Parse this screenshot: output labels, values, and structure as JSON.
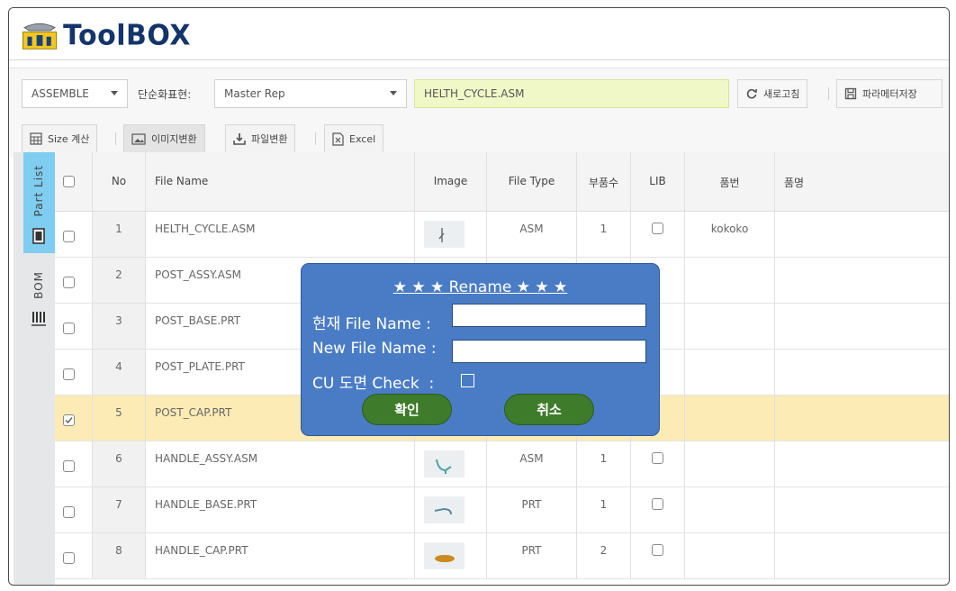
{
  "app": {
    "title": "ToolBOX"
  },
  "toolbar": {
    "assemble_value": "ASSEMBLE",
    "simplified_rep_label": "단순화표현:",
    "simplified_rep_value": "Master Rep",
    "filename_value": "HELTH_CYCLE.ASM",
    "refresh_label": "새로고침",
    "save_params_label": "파라메터저장",
    "size_calc_label": "Size 계산",
    "image_convert_label": "이미지변환",
    "file_convert_label": "파일변환",
    "excel_label": "Excel"
  },
  "sidebar": {
    "part_list_label": "Part List",
    "bom_label": "BOM"
  },
  "table": {
    "headers": {
      "no": "No",
      "file_name": "File Name",
      "image": "Image",
      "file_type": "File Type",
      "qty": "부품수",
      "lib": "LIB",
      "part_no": "품번",
      "part_name": "품명"
    },
    "rows": [
      {
        "no": "1",
        "file_name": "HELTH_CYCLE.ASM",
        "file_type": "ASM",
        "qty": "1",
        "part_no": "kokoko",
        "part_name": ""
      },
      {
        "no": "2",
        "file_name": "POST_ASSY.ASM",
        "file_type": "",
        "qty": "",
        "part_no": "",
        "part_name": ""
      },
      {
        "no": "3",
        "file_name": "POST_BASE.PRT",
        "file_type": "",
        "qty": "",
        "part_no": "",
        "part_name": ""
      },
      {
        "no": "4",
        "file_name": "POST_PLATE.PRT",
        "file_type": "",
        "qty": "",
        "part_no": "",
        "part_name": ""
      },
      {
        "no": "5",
        "file_name": "POST_CAP.PRT",
        "file_type": "",
        "qty": "",
        "part_no": "",
        "part_name": ""
      },
      {
        "no": "6",
        "file_name": "HANDLE_ASSY.ASM",
        "file_type": "ASM",
        "qty": "1",
        "part_no": "",
        "part_name": ""
      },
      {
        "no": "7",
        "file_name": "HANDLE_BASE.PRT",
        "file_type": "PRT",
        "qty": "1",
        "part_no": "",
        "part_name": ""
      },
      {
        "no": "8",
        "file_name": "HANDLE_CAP.PRT",
        "file_type": "PRT",
        "qty": "2",
        "part_no": "",
        "part_name": ""
      }
    ]
  },
  "dialog": {
    "title": "★ ★ ★ Rename ★ ★ ★",
    "current_label": "현재 File Name :",
    "current_value": "",
    "new_label": "New File Name :",
    "new_value": "",
    "cu_check_label": "CU 도면 Check  :",
    "confirm_label": "확인",
    "cancel_label": "취소"
  },
  "colors": {
    "dialog_bg": "#4a7cc6",
    "button_green": "#3e7b2a",
    "selected_row": "#fdebb6",
    "filename_highlight": "#f1f8c8",
    "part_list_tab": "#7fcdf0",
    "logo_navy": "#14346b"
  }
}
